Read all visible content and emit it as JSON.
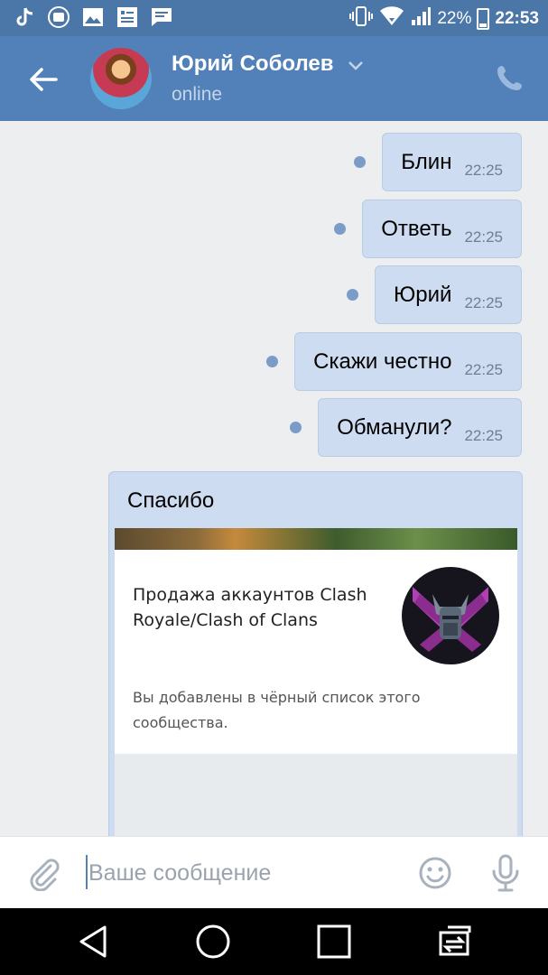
{
  "status_bar": {
    "icons": [
      "tiktok-icon",
      "mi-icon",
      "gallery-icon",
      "sim-toolkit-icon",
      "chat-icon",
      "vibrate-icon",
      "wifi-icon",
      "signal-icon",
      "battery-icon"
    ],
    "battery": "22%",
    "time": "22:53"
  },
  "header": {
    "name": "Юрий Соболев",
    "status": "online"
  },
  "messages": [
    {
      "text": "Блин",
      "time": "22:25"
    },
    {
      "text": "Ответь",
      "time": "22:25"
    },
    {
      "text": "Юрий",
      "time": "22:25"
    },
    {
      "text": "Скажи честно",
      "time": "22:25"
    },
    {
      "text": "Обманули?",
      "time": "22:25"
    }
  ],
  "forwarded": {
    "text": "Спасибо",
    "card_title": "Продажа аккаунтов Clash Royale/Clash of Clans",
    "card_note": "Вы добавлены в чёрный список этого сообщества."
  },
  "composer": {
    "placeholder": "Ваше сообщение"
  },
  "colors": {
    "header": "#5181b8",
    "status_bar": "#4a76a8",
    "bubble": "#cddcf0",
    "unread_dot": "#7b9cc8"
  }
}
